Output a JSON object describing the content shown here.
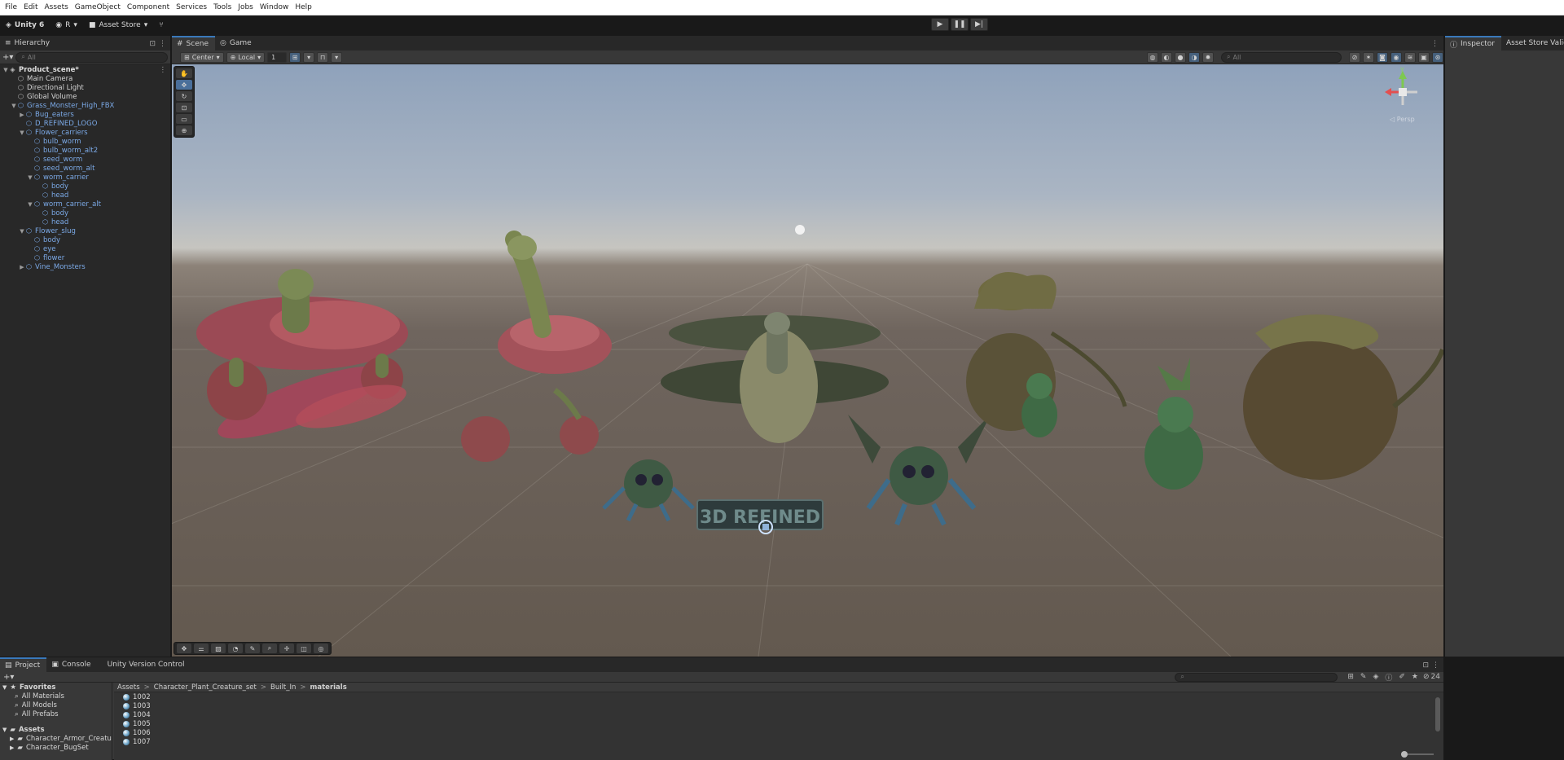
{
  "menu": [
    "File",
    "Edit",
    "Assets",
    "GameObject",
    "Component",
    "Services",
    "Tools",
    "Jobs",
    "Window",
    "Help"
  ],
  "toolbar": {
    "app_name": "Unity 6",
    "account_initial": "R",
    "asset_store": "Asset Store"
  },
  "hierarchy": {
    "tab_label": "Hierarchy",
    "search_placeholder": "All",
    "rows": [
      {
        "label": "Product_scene*",
        "indent": 0,
        "arrow": "▼",
        "kind": "scene"
      },
      {
        "label": "Main Camera",
        "indent": 1,
        "arrow": "",
        "kind": "object"
      },
      {
        "label": "Directional Light",
        "indent": 1,
        "arrow": "",
        "kind": "object"
      },
      {
        "label": "Global Volume",
        "indent": 1,
        "arrow": "",
        "kind": "object"
      },
      {
        "label": "Grass_Monster_High_FBX",
        "indent": 1,
        "arrow": "▼",
        "kind": "prefab"
      },
      {
        "label": "Bug_eaters",
        "indent": 2,
        "arrow": "▶",
        "kind": "prefab"
      },
      {
        "label": "D_REFINED_LOGO",
        "indent": 2,
        "arrow": "",
        "kind": "prefab"
      },
      {
        "label": "Flower_carriers",
        "indent": 2,
        "arrow": "▼",
        "kind": "prefab"
      },
      {
        "label": "bulb_worm",
        "indent": 3,
        "arrow": "",
        "kind": "prefab"
      },
      {
        "label": "bulb_worm_alt2",
        "indent": 3,
        "arrow": "",
        "kind": "prefab"
      },
      {
        "label": "seed_worm",
        "indent": 3,
        "arrow": "",
        "kind": "prefab"
      },
      {
        "label": "seed_worm_alt",
        "indent": 3,
        "arrow": "",
        "kind": "prefab"
      },
      {
        "label": "worm_carrier",
        "indent": 3,
        "arrow": "▼",
        "kind": "prefab"
      },
      {
        "label": "body",
        "indent": 4,
        "arrow": "",
        "kind": "prefab"
      },
      {
        "label": "head",
        "indent": 4,
        "arrow": "",
        "kind": "prefab"
      },
      {
        "label": "worm_carrier_alt",
        "indent": 3,
        "arrow": "▼",
        "kind": "prefab"
      },
      {
        "label": "body",
        "indent": 4,
        "arrow": "",
        "kind": "prefab"
      },
      {
        "label": "head",
        "indent": 4,
        "arrow": "",
        "kind": "prefab"
      },
      {
        "label": "Flower_slug",
        "indent": 2,
        "arrow": "▼",
        "kind": "prefab"
      },
      {
        "label": "body",
        "indent": 3,
        "arrow": "",
        "kind": "prefab"
      },
      {
        "label": "eye",
        "indent": 3,
        "arrow": "",
        "kind": "prefab"
      },
      {
        "label": "flower",
        "indent": 3,
        "arrow": "",
        "kind": "prefab"
      },
      {
        "label": "Vine_Monsters",
        "indent": 2,
        "arrow": "▶",
        "kind": "prefab"
      }
    ]
  },
  "scene_tabs": {
    "scene": "Scene",
    "game": "Game"
  },
  "scene_toolbar": {
    "pivot": "Center",
    "space": "Local",
    "grid_size": "1",
    "search_placeholder": "All",
    "persp_label": "◁ Persp",
    "logo_text": "3D REFINED"
  },
  "gizmo_axes": {
    "y": "y"
  },
  "inspector": {
    "tab_label": "Inspector",
    "tab2_label": "Asset Store Valid"
  },
  "project": {
    "tabs": [
      "Project",
      "Console",
      "Unity Version Control"
    ],
    "favorites_label": "Favorites",
    "favorites": [
      "All Materials",
      "All Models",
      "All Prefabs"
    ],
    "assets_label": "Assets",
    "asset_folders": [
      "Character_Armor_Creatur",
      "Character_BugSet"
    ],
    "path": [
      "Assets",
      "Character_Plant_Creature_set",
      "Built_In",
      "materials"
    ],
    "materials": [
      "1002",
      "1003",
      "1004",
      "1005",
      "1006",
      "1007"
    ],
    "item_count": "24"
  }
}
